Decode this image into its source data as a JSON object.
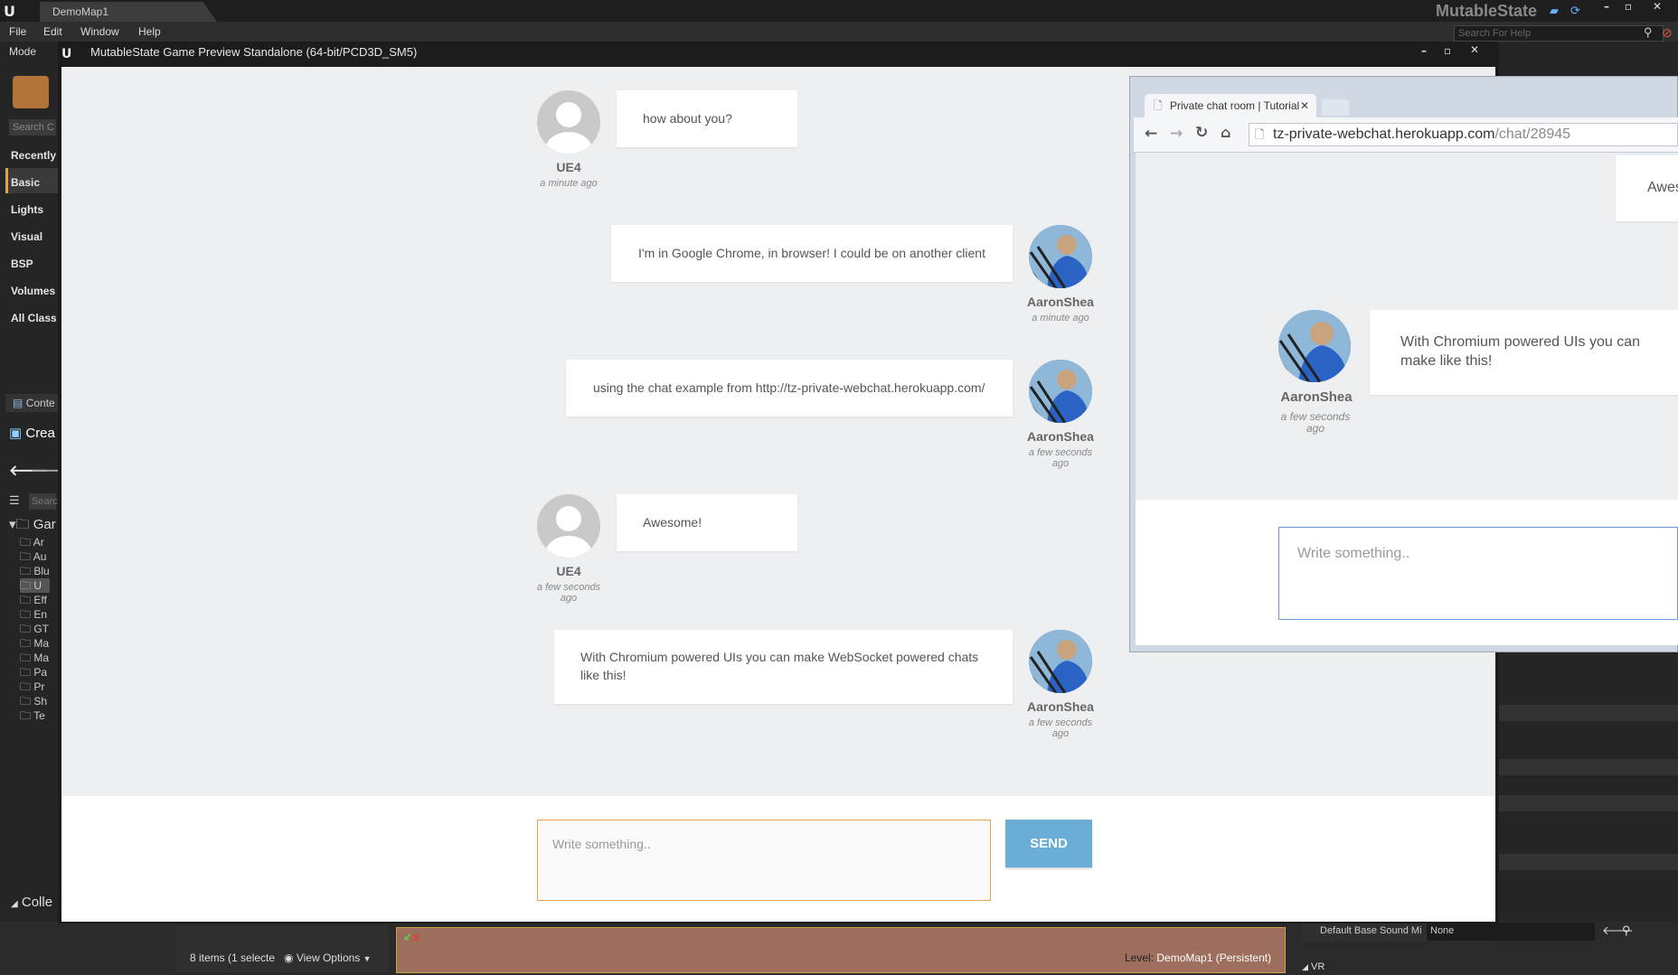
{
  "editor": {
    "tab_title": "DemoMap1",
    "brand": "MutableState",
    "menu": [
      "File",
      "Edit",
      "Window",
      "Help"
    ],
    "help_search_placeholder": "Search For Help",
    "modes_label": "Mode",
    "search_classes_placeholder": "Search C",
    "place_categories": [
      "Recently",
      "Basic",
      "Lights",
      "Visual",
      "BSP",
      "Volumes",
      "All Class"
    ],
    "content_tab": "Conte",
    "create_label": "Crea",
    "collections_label": "Colle",
    "items_status": "8 items (1 selecte",
    "view_options": "View Options",
    "level_label": "Level:",
    "level_name": "DemoMap1 (Persistent)",
    "details_default_sound_label": "Default Base Sound Mi",
    "details_default_sound_value": "None",
    "details_section_vr": "VR",
    "folder_tree_root": "Gar",
    "folder_tree_items": [
      "Ar",
      "Au",
      "Blu",
      "U",
      "Eff",
      "En",
      "GT",
      "Ma",
      "Ma",
      "Pa",
      "Pr",
      "Sh",
      "Te"
    ]
  },
  "game_window": {
    "title": "MutableState Game Preview Standalone (64-bit/PCD3D_SM5)"
  },
  "chat": {
    "messages": [
      {
        "user": "UE4",
        "time": "a minute ago",
        "text": "how about you?",
        "side": "left"
      },
      {
        "user": "AaronShea",
        "time": "a minute ago",
        "text": "I'm in Google Chrome, in browser! I could be on another client",
        "side": "right"
      },
      {
        "user": "AaronShea",
        "time": "a few seconds ago",
        "text": "using the chat example from http://tz-private-webchat.herokuapp.com/",
        "side": "right"
      },
      {
        "user": "UE4",
        "time": "a few seconds ago",
        "text": "Awesome!",
        "side": "left"
      },
      {
        "user": "AaronShea",
        "time": "a few seconds ago",
        "text": "With Chromium powered UIs you can make WebSocket powered chats like this!",
        "side": "right"
      }
    ],
    "input_placeholder": "Write something..",
    "send_label": "SEND"
  },
  "browser": {
    "tab_title": "Private chat room | Tutorial",
    "url_host": "tz-private-webchat.herokuapp.com",
    "url_path": "/chat/28945",
    "partial_message": "Awes",
    "message": {
      "user": "AaronShea",
      "time": "a few seconds ago",
      "text": "With Chromium powered UIs you can make like this!"
    },
    "input_placeholder": "Write something.."
  },
  "colors": {
    "send_button": "#6aaed6",
    "input_border_focus": "#e0a24a",
    "chrome_input_border": "#6a9bd8",
    "chat_bg": "#eeeff1"
  }
}
